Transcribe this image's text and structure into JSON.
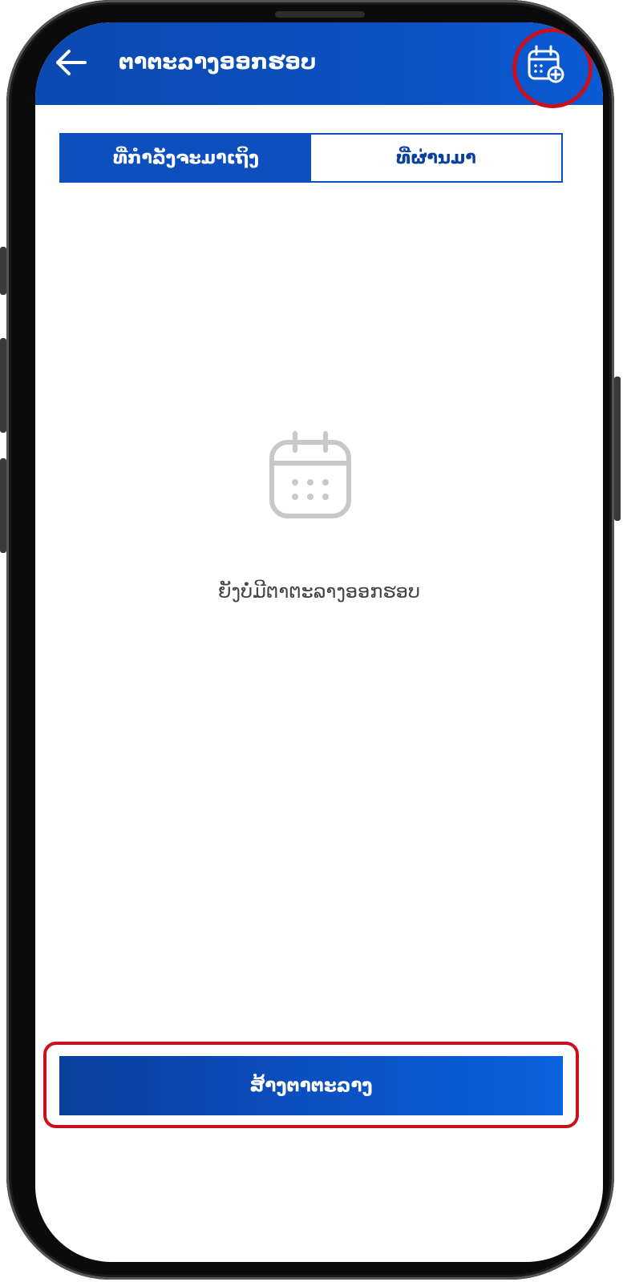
{
  "header": {
    "title": "ຕາຕະລາງອອກຮອບ",
    "back_icon": "arrow-left-icon",
    "action_icon": "calendar-add-icon"
  },
  "tabs": [
    {
      "label": "ທີ່ກຳລັງຈະມາເຖິງ",
      "active": true
    },
    {
      "label": "ທີ່ຜ່ານມາ",
      "active": false
    }
  ],
  "empty_state": {
    "icon": "calendar-icon",
    "message": "ຍັງບໍ່ມີຕາຕະລາງອອກຮອບ"
  },
  "footer": {
    "create_label": "ສ້າງຕາຕະລາງ"
  },
  "colors": {
    "primary": "#0c4fbd",
    "highlight": "#c8101e",
    "empty_icon": "#c8c8c8"
  }
}
